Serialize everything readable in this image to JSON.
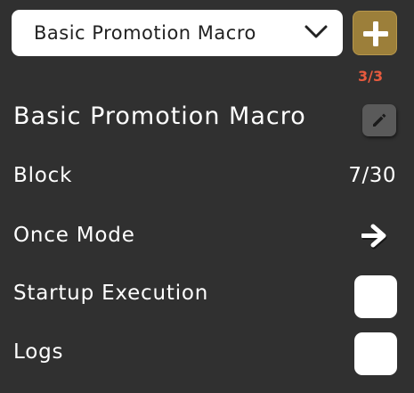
{
  "selector": {
    "selected": "Basic Promotion Macro",
    "chevron_icon": "chevron-down-icon"
  },
  "add_button": {
    "icon": "plus-icon",
    "color": "#9c7f3a"
  },
  "counter": "3/3",
  "macro": {
    "name": "Basic Promotion Macro",
    "edit_icon": "pencil-icon"
  },
  "settings": {
    "block_label": "Block",
    "block_value": "7/30",
    "once_mode_label": "Once Mode",
    "once_mode_icon": "arrow-right-icon",
    "startup_label": "Startup Execution",
    "startup_checked": false,
    "logs_label": "Logs",
    "logs_checked": false
  },
  "colors": {
    "background": "#303030",
    "counter": "#e65a3e"
  }
}
